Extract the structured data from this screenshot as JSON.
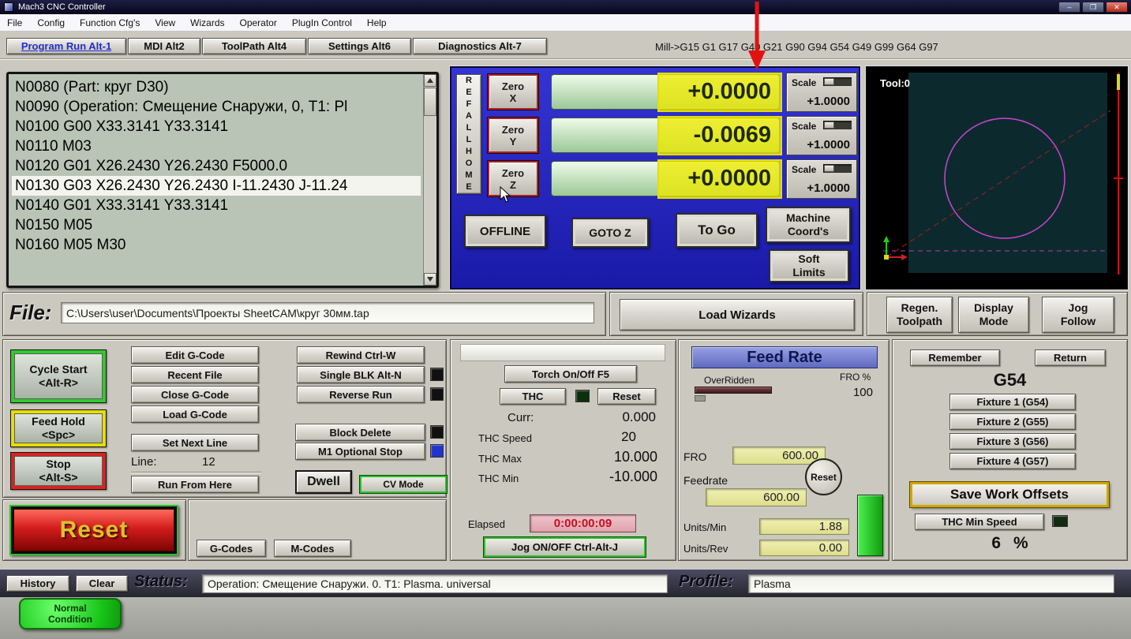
{
  "window": {
    "title": "Mach3 CNC Controller",
    "minimize": "–",
    "maximize": "❐",
    "close": "✕"
  },
  "menu": {
    "items": [
      "File",
      "Config",
      "Function Cfg's",
      "View",
      "Wizards",
      "Operator",
      "PlugIn Control",
      "Help"
    ]
  },
  "tabs": {
    "program_run": "Program Run Alt-1",
    "mdi": "MDI Alt2",
    "toolpath": "ToolPath Alt4",
    "settings": "Settings Alt6",
    "diagnostics": "Diagnostics Alt-7",
    "modes": "Mill->G15  G1 G17 G40 G21 G90 G94 G54 G49 G99 G64 G97"
  },
  "gcode": {
    "lines": [
      "N0080 (Part: круг D30)",
      "N0090 (Operation: Смещение Снаружи, 0, T1: Pl",
      "N0100 G00 X33.3141 Y33.3141",
      "N0110 M03",
      "N0120 G01 X26.2430 Y26.2430 F5000.0",
      "N0130 G03 X26.2430 Y26.2430 I-11.2430 J-11.24",
      "N0140 G01 X33.3141 Y33.3141",
      "N0150 M05",
      "N0160 M05 M30"
    ]
  },
  "dro": {
    "ref_all_home": "R\nE\nF\nA\nL\nL\nH\nO\nM\nE",
    "zero_x": "Zero\nX",
    "zero_y": "Zero\nY",
    "zero_z": "Zero\nZ",
    "x_value": "+0.0000",
    "y_value": "-0.0069",
    "z_value": "+0.0000",
    "scale_label": "Scale",
    "x_scale": "+1.0000",
    "y_scale": "+1.0000",
    "z_scale": "+1.0000",
    "offline": "OFFLINE",
    "goto_z": "GOTO Z",
    "to_go": "To Go",
    "machine_coords": "Machine\nCoord's",
    "soft_limits": "Soft\nLimits"
  },
  "toolpath_panel": {
    "tool_label": "Tool:0"
  },
  "file_row": {
    "label": "File:",
    "path": "C:\\Users\\user\\Documents\\Проекты SheetCAM\\круг 30мм.tap",
    "load_wizards": "Load Wizards",
    "regen_toolpath": "Regen.\nToolpath",
    "display_mode": "Display\nMode",
    "jog_follow": "Jog\nFollow"
  },
  "run_controls": {
    "cycle_start": "Cycle Start\n<Alt-R>",
    "feed_hold": "Feed Hold\n<Spc>",
    "stop": "Stop\n<Alt-S>",
    "reset": "Reset",
    "edit_gcode": "Edit G-Code",
    "recent_file": "Recent File",
    "close_gcode": "Close G-Code",
    "load_gcode": "Load G-Code",
    "set_next_line": "Set Next Line",
    "line_label": "Line:",
    "line_value": "12",
    "run_from_here": "Run From Here",
    "rewind": "Rewind Ctrl-W",
    "single_blk": "Single BLK Alt-N",
    "reverse_run": "Reverse Run",
    "block_delete": "Block Delete",
    "m1_optional_stop": "M1 Optional Stop",
    "dwell": "Dwell",
    "cv_mode": "CV Mode",
    "g_codes": "G-Codes",
    "m_codes": "M-Codes"
  },
  "torch": {
    "torch_on_off": "Torch On/Off F5",
    "thc": "THC",
    "reset": "Reset",
    "curr_label": "Curr:",
    "curr_value": "0.000",
    "thc_speed_label": "THC Speed",
    "thc_speed_value": "20",
    "thc_max_label": "THC Max",
    "thc_max_value": "10.000",
    "thc_min_label": "THC Min",
    "thc_min_value": "-10.000",
    "elapsed_label": "Elapsed",
    "elapsed_value": "0:00:00:09",
    "jog_on_off": "Jog ON/OFF Ctrl-Alt-J"
  },
  "feed_rate": {
    "title": "Feed Rate",
    "overridden_label": "OverRidden",
    "fro_pct_label": "FRO %",
    "fro_pct_value": "100",
    "fro_label": "FRO",
    "fro_value": "600.00",
    "feedrate_label": "Feedrate",
    "reset": "Reset",
    "feedrate_value": "600.00",
    "units_min_label": "Units/Min",
    "units_min_value": "1.88",
    "units_rev_label": "Units/Rev",
    "units_rev_value": "0.00"
  },
  "offsets": {
    "remember": "Remember",
    "return": "Return",
    "current": "G54",
    "fixture1": "Fixture 1 (G54)",
    "fixture2": "Fixture 2 (G55)",
    "fixture3": "Fixture 3 (G56)",
    "fixture4": "Fixture 4 (G57)",
    "save": "Save Work Offsets",
    "thc_min_speed": "THC Min Speed",
    "percent_value": "6",
    "percent_unit": "%"
  },
  "status_bar": {
    "history": "History",
    "clear": "Clear",
    "status_label": "Status:",
    "status_value": "Operation: Смещение Снаружи. 0. T1: Plasma. universal",
    "profile_label": "Profile:",
    "profile_value": "Plasma"
  },
  "lamp": {
    "normal_condition": "Normal\nCondition"
  },
  "colors": {
    "dro_highlight": "#e8e400",
    "dro_panel_blue": "#2424c4",
    "led_blue": "#2233cc",
    "led_black": "#101010",
    "led_dark_green": "#0c2f0c",
    "green_lamp": "#2ddd2d",
    "elapsed_red": "#c40f20",
    "circle_magenta": "#cc44cc"
  }
}
